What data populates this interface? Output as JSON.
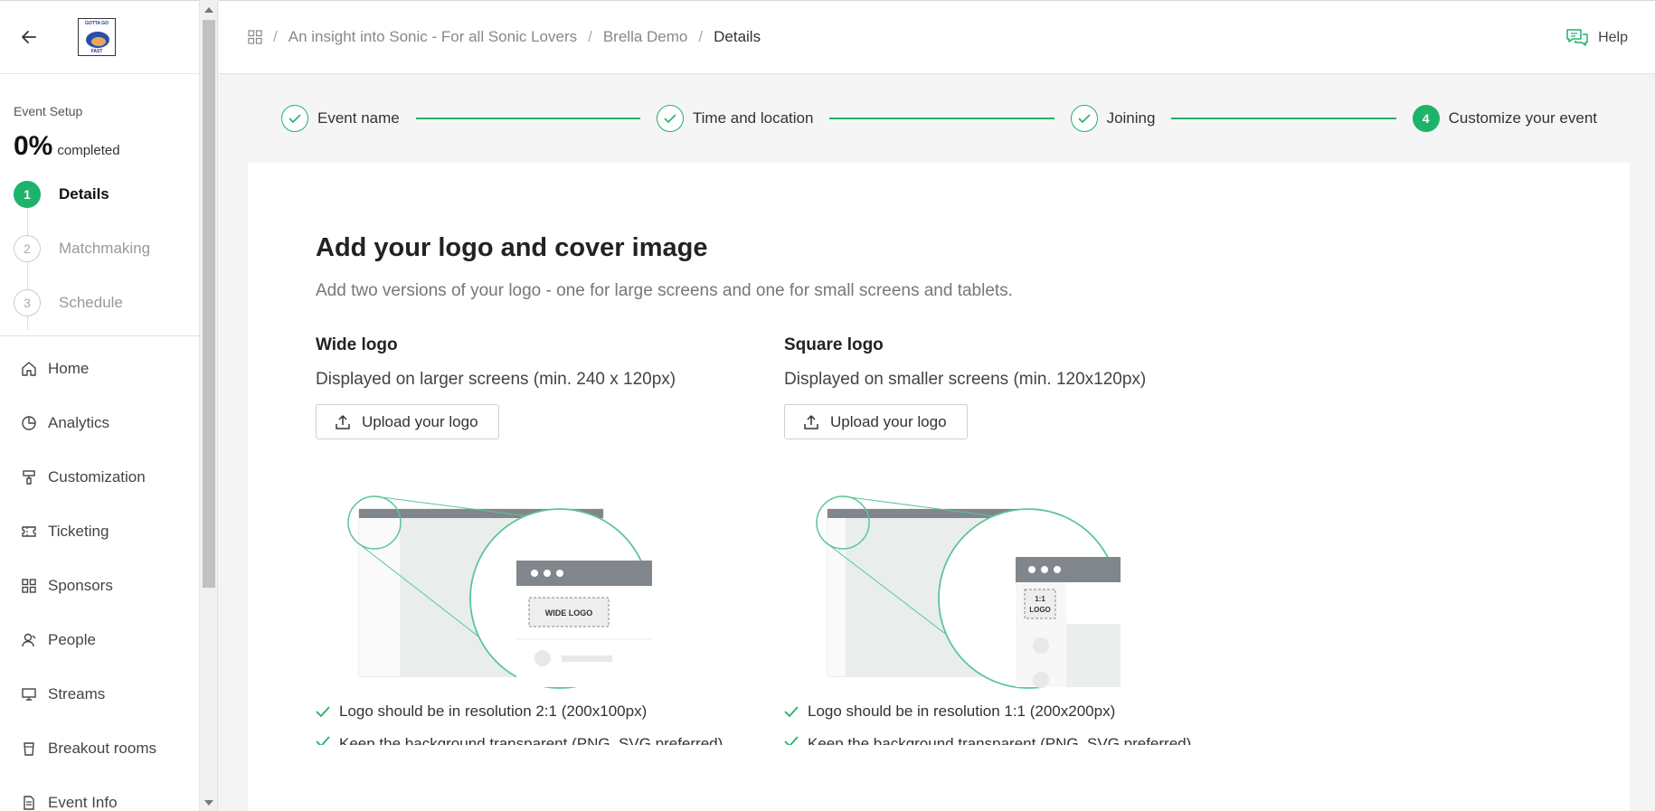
{
  "sidebar": {
    "setup_title": "Event Setup",
    "progress_value": "0%",
    "progress_label": "completed",
    "steps": [
      {
        "num": "1",
        "label": "Details"
      },
      {
        "num": "2",
        "label": "Matchmaking"
      },
      {
        "num": "3",
        "label": "Schedule"
      }
    ],
    "nav": [
      {
        "label": "Home",
        "icon": "home-icon"
      },
      {
        "label": "Analytics",
        "icon": "pie-chart-icon"
      },
      {
        "label": "Customization",
        "icon": "paint-roller-icon"
      },
      {
        "label": "Ticketing",
        "icon": "ticket-icon"
      },
      {
        "label": "Sponsors",
        "icon": "grid-icon"
      },
      {
        "label": "People",
        "icon": "people-icon"
      },
      {
        "label": "Streams",
        "icon": "monitor-icon"
      },
      {
        "label": "Breakout rooms",
        "icon": "cup-icon"
      },
      {
        "label": "Event Info",
        "icon": "document-icon"
      }
    ],
    "logo_text_top": "GOTTA GO",
    "logo_text_bottom": "FAST"
  },
  "header": {
    "breadcrumbs": [
      "An insight into Sonic - For all Sonic Lovers",
      "Brella Demo",
      "Details"
    ],
    "help_label": "Help"
  },
  "stepper": {
    "steps": [
      {
        "label": "Event name",
        "state": "done"
      },
      {
        "label": "Time and location",
        "state": "done"
      },
      {
        "label": "Joining",
        "state": "done"
      },
      {
        "label": "Customize your event",
        "state": "current",
        "num": "4"
      }
    ]
  },
  "main": {
    "title": "Add your logo and cover image",
    "subtitle": "Add two versions of your logo - one for large screens and one for small screens and tablets.",
    "wide": {
      "title": "Wide logo",
      "desc": "Displayed on larger screens (min. 240 x 120px)",
      "upload_label": "Upload your logo",
      "illus_label": "WIDE LOGO",
      "bullets": [
        "Logo should be in resolution 2:1 (200x100px)",
        "Keep the background transparent (PNG, SVG preferred)"
      ]
    },
    "square": {
      "title": "Square logo",
      "desc": "Displayed on smaller screens (min. 120x120px)",
      "upload_label": "Upload your logo",
      "illus_label_1": "1:1",
      "illus_label_2": "LOGO",
      "bullets": [
        "Logo should be in resolution 1:1 (200x200px)",
        "Keep the background transparent (PNG, SVG preferred)"
      ]
    }
  },
  "colors": {
    "accent": "#1db36b",
    "illustration_green": "#5cc49a"
  }
}
